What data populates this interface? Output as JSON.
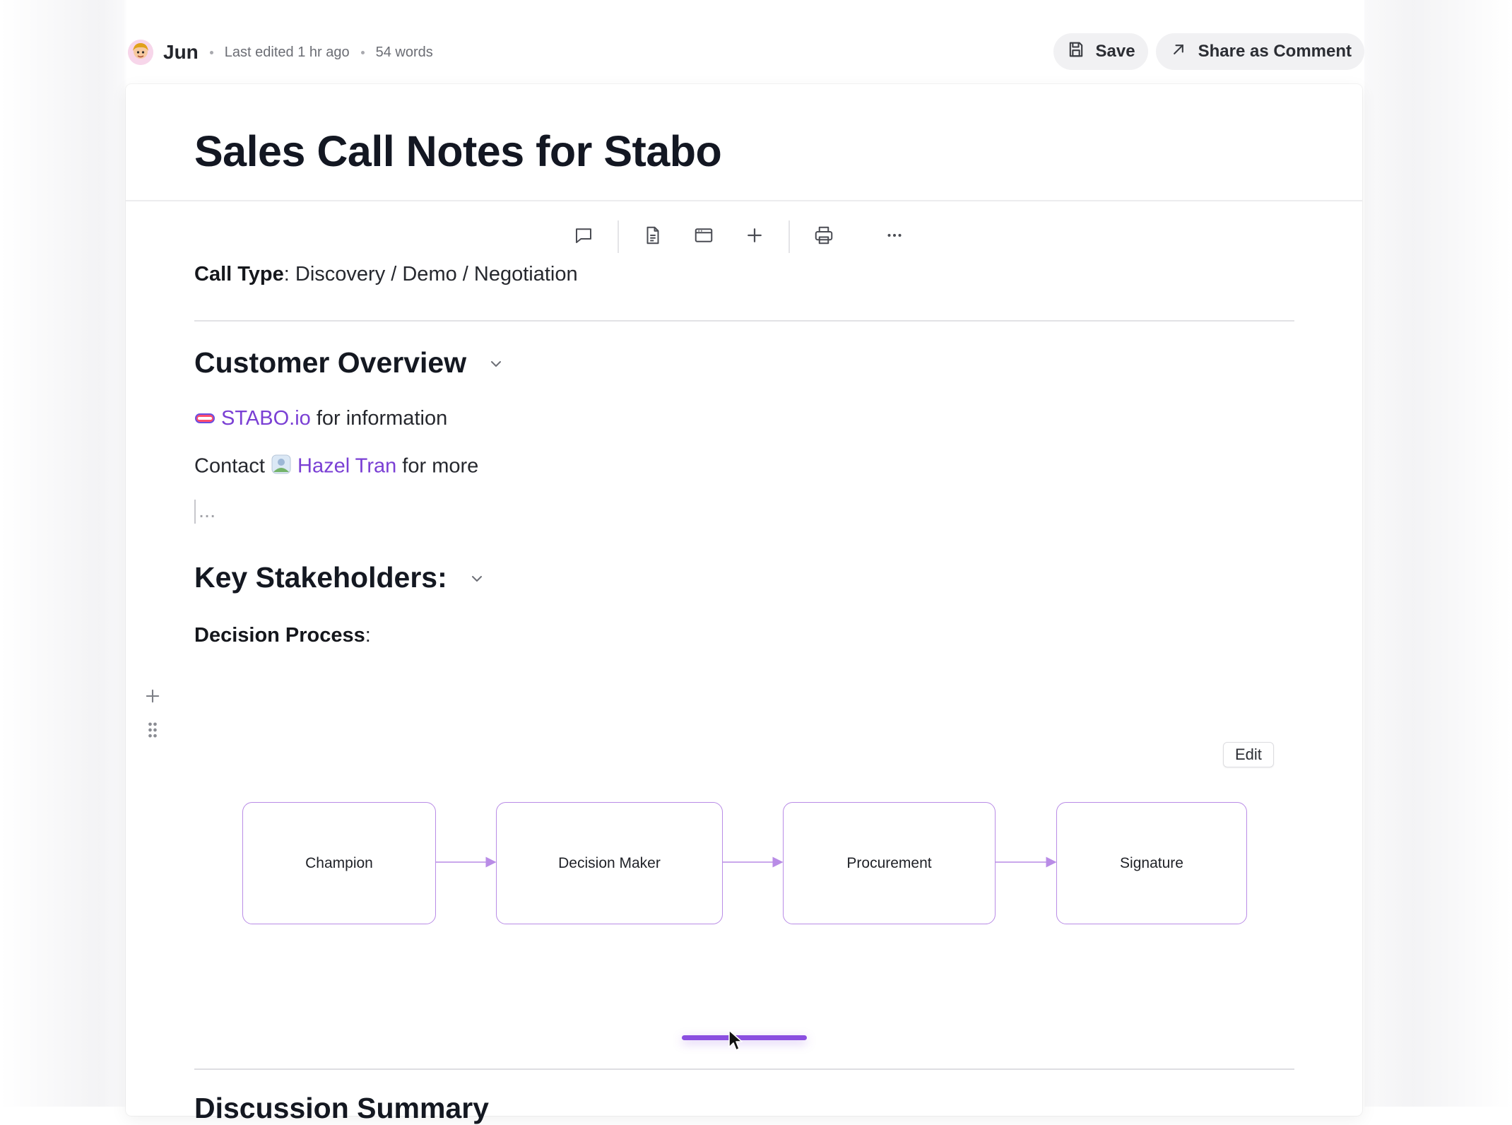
{
  "header": {
    "author": "Jun",
    "last_edited": "Last edited 1 hr ago",
    "word_count": "54 words",
    "save_label": "Save",
    "share_label": "Share as Comment"
  },
  "document": {
    "title": "Sales Call Notes for Stabo",
    "call_type_label": "Call Type",
    "call_type_value": ": Discovery / Demo / Negotiation",
    "customer_overview": {
      "heading": "Customer Overview",
      "company_link": "STABO.io",
      "company_suffix": " for information",
      "contact_prefix": "Contact ",
      "contact_link": "Hazel Tran",
      "contact_suffix": " for more",
      "placeholder": "..."
    },
    "key_stakeholders": {
      "heading": "Key Stakeholders:",
      "decision_label": "Decision Process",
      "decision_colon": ":"
    },
    "next_heading_partial": "Discussion Summary"
  },
  "diagram": {
    "edit_label": "Edit",
    "nodes": [
      "Champion",
      "Decision Maker",
      "Procurement",
      "Signature"
    ],
    "accent_color": "#b98ce6"
  },
  "toolbar": {
    "icons": [
      "comment-icon",
      "document-icon",
      "window-icon",
      "plus-icon",
      "printer-icon",
      "more-icon"
    ]
  },
  "colors": {
    "mention": "#7a3fd4",
    "scroll_handle": "#8b4fe0"
  }
}
